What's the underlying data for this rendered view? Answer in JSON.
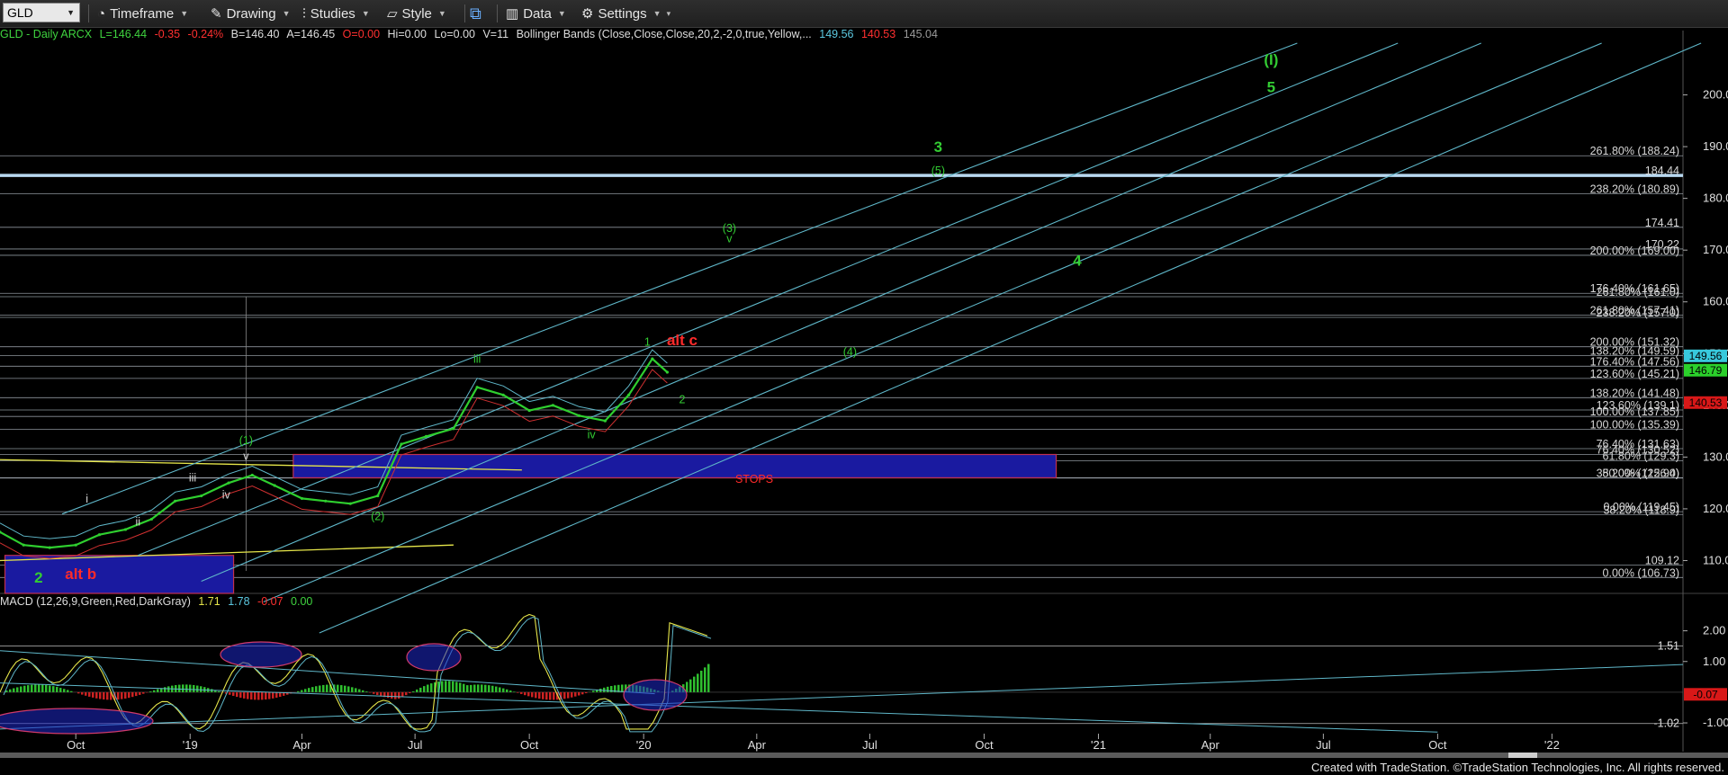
{
  "toolbar": {
    "symbol": "GLD",
    "timeframe": "Timeframe",
    "drawing": "Drawing",
    "studies": "Studies",
    "style": "Style",
    "data": "Data",
    "settings": "Settings"
  },
  "info": {
    "symbol_desc": "GLD - Daily  ARCX",
    "last": "L=146.44",
    "change": "-0.35",
    "pct": "-0.24%",
    "bid": "B=146.40",
    "ask": "A=146.45",
    "open": "O=0.00",
    "hi": "Hi=0.00",
    "lo": "Lo=0.00",
    "vol": "V=11",
    "bb_label": "Bollinger Bands (Close,Close,Close,20,2,-2,0,true,Yellow,...",
    "bb_upper": "149.56",
    "bb_lower": "140.53",
    "bb_mid": "145.04"
  },
  "macd_info": {
    "label": "MACD (12,26,9,Green,Red,DarkGray)",
    "macd": "1.71",
    "signal": "1.78",
    "diff": "-0.07",
    "zero": "0.00"
  },
  "colors": {
    "up": "#22c42a",
    "down": "#e02020",
    "channel": "#5fb7c9",
    "fib": "#c9d3dd",
    "label_green": "#33cc33",
    "label_red": "#ff2a2a",
    "label_white": "#d8d8d8",
    "box_blue": "#1a1aa0",
    "yellow": "#e6e64a"
  },
  "chart_data": {
    "type": "line",
    "title": "",
    "price_axis": {
      "ticks": [
        110,
        120,
        130,
        140,
        150,
        160,
        170,
        180,
        190,
        200
      ],
      "ylim": [
        104,
        210
      ]
    },
    "macd_axis": {
      "ticks": [
        -1.0,
        1.0,
        2.0
      ],
      "ylim": [
        -1.35,
        2.75
      ]
    },
    "x_ticks": [
      "Oct",
      "'19",
      "Apr",
      "Jul",
      "Oct",
      "'20",
      "Apr",
      "Jul",
      "Oct",
      "'21",
      "Apr",
      "Jul",
      "Oct",
      "'22"
    ],
    "series": [
      {
        "x": [
          "2018-08-01",
          "2018-08-20",
          "2018-09-10",
          "2018-10-01",
          "2018-10-20",
          "2018-11-10",
          "2018-12-01",
          "2018-12-20",
          "2019-01-10",
          "2019-02-01",
          "2019-02-20",
          "2019-03-10",
          "2019-04-01",
          "2019-04-20",
          "2019-05-10",
          "2019-06-01",
          "2019-06-20",
          "2019-07-10",
          "2019-08-01",
          "2019-08-20",
          "2019-09-10",
          "2019-10-01",
          "2019-10-20",
          "2019-11-10",
          "2019-12-01",
          "2019-12-20",
          "2020-01-08",
          "2020-01-20"
        ],
        "values": [
          115.5,
          113.0,
          112.5,
          113.0,
          115.0,
          116.0,
          118.0,
          121.5,
          122.5,
          125.0,
          126.5,
          124.5,
          122.0,
          121.5,
          121.0,
          122.5,
          132.5,
          134.0,
          135.5,
          143.5,
          142.0,
          139.0,
          140.0,
          138.0,
          137.0,
          142.0,
          149.0,
          146.4
        ]
      }
    ],
    "price_labels": [
      {
        "text": "261.80% (188.24)",
        "value": 188.24
      },
      {
        "text": "184.44",
        "value": 184.44
      },
      {
        "text": "238.20% (180.89)",
        "value": 180.89
      },
      {
        "text": "174.41",
        "value": 174.41
      },
      {
        "text": "170.22",
        "value": 170.22
      },
      {
        "text": "200.00% (169.00)",
        "value": 169.0
      },
      {
        "text": "176.40% (161.65)",
        "value": 161.65
      },
      {
        "text": "261.80% (161.0)",
        "value": 161.0
      },
      {
        "text": "261.80% (157.41)",
        "value": 157.41
      },
      {
        "text": "238.20% (157.0)",
        "value": 157.0
      },
      {
        "text": "200.00% (151.32)",
        "value": 151.32
      },
      {
        "text": "138.20% (149.59)",
        "value": 149.59
      },
      {
        "text": "176.40% (147.56)",
        "value": 147.56
      },
      {
        "text": "123.60% (145.21)",
        "value": 145.21
      },
      {
        "text": "138.20% (141.48)",
        "value": 141.48
      },
      {
        "text": "123.60% (139.1)",
        "value": 139.1
      },
      {
        "text": "100.00% (137.85)",
        "value": 137.85
      },
      {
        "text": "100.00% (135.39)",
        "value": 135.39
      },
      {
        "text": "76.40% (131.63)",
        "value": 131.63
      },
      {
        "text": "76.40% (130.52)",
        "value": 130.52
      },
      {
        "text": "61.80% (129.3)",
        "value": 129.3
      },
      {
        "text": "50.00% (126.0)",
        "value": 126.0
      },
      {
        "text": "38.20% (125.94)",
        "value": 125.94
      },
      {
        "text": "0.00% (119.45)",
        "value": 119.45
      },
      {
        "text": "38.20% (118.9)",
        "value": 118.9
      },
      {
        "text": "109.12",
        "value": 109.12
      },
      {
        "text": "0.00% (106.73)",
        "value": 106.73
      }
    ],
    "macd_labels": [
      {
        "text": "1.51",
        "value": 1.51
      },
      {
        "text": "-1.02",
        "value": -1.02
      }
    ],
    "badges": [
      {
        "text": "149.56",
        "value": 149.56,
        "color": "#38c9dc"
      },
      {
        "text": "146.79",
        "value": 146.79,
        "color": "#2bd02b"
      },
      {
        "text": "140.53",
        "value": 140.53,
        "color": "#d81818"
      },
      {
        "text": "-0.07",
        "value": -0.07,
        "color": "#d81818",
        "pane": "macd"
      }
    ],
    "wave_labels": [
      {
        "text": "(I)",
        "color": "green",
        "big": true
      },
      {
        "text": "5",
        "color": "green",
        "big": true
      },
      {
        "text": "3",
        "color": "green",
        "big": true
      },
      {
        "text": "(5)",
        "color": "green"
      },
      {
        "text": "(3)",
        "color": "green"
      },
      {
        "text": "v",
        "color": "green"
      },
      {
        "text": "4",
        "color": "green",
        "big": true
      },
      {
        "text": "(4)",
        "color": "green"
      },
      {
        "text": "1",
        "color": "green"
      },
      {
        "text": "alt c",
        "color": "red",
        "big": true
      },
      {
        "text": "2",
        "color": "green"
      },
      {
        "text": "iii",
        "color": "green"
      },
      {
        "text": "iv",
        "color": "green"
      },
      {
        "text": "(1)",
        "color": "green"
      },
      {
        "text": "v",
        "color": "white"
      },
      {
        "text": "iii",
        "color": "white"
      },
      {
        "text": "iv",
        "color": "white"
      },
      {
        "text": "i",
        "color": "white"
      },
      {
        "text": "ii",
        "color": "white"
      },
      {
        "text": "(2)",
        "color": "green"
      },
      {
        "text": "2",
        "color": "green",
        "big": true
      },
      {
        "text": "alt b",
        "color": "red",
        "big": true
      },
      {
        "text": "STOPS",
        "color": "red"
      }
    ]
  },
  "credit": "Created with TradeStation. ©TradeStation Technologies, Inc. All rights reserved."
}
